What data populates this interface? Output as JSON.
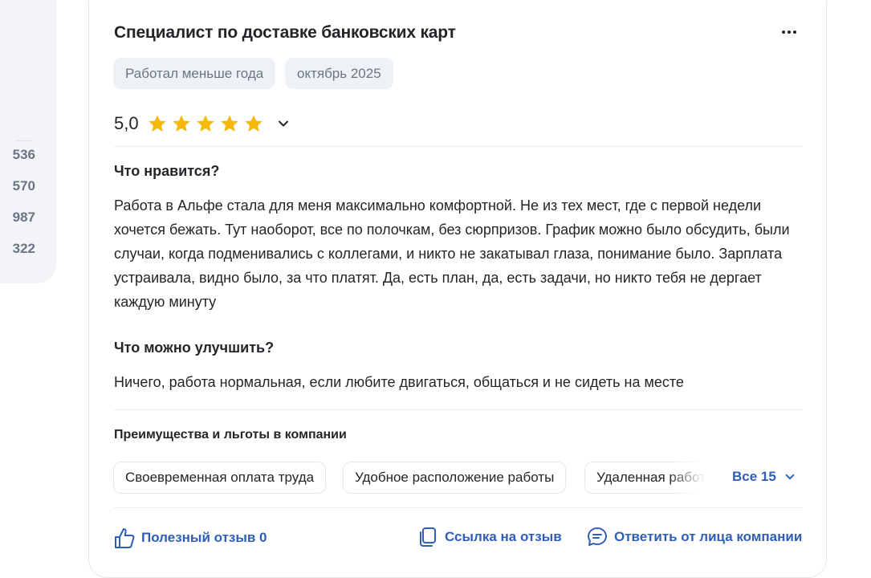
{
  "sidebar": {
    "stats": [
      "536",
      "570",
      "987",
      "322"
    ]
  },
  "review": {
    "title": "Специалист по доставке банковских карт",
    "tags": [
      "Работал меньше года",
      "октябрь 2025"
    ],
    "rating": "5,0",
    "stars": 5,
    "likes_heading": "Что нравится?",
    "likes_text": "Работа в Альфе стала для меня максимально комфортной. Не из тех мест, где с первой недели хочется бежать. Тут наоборот, все по полочкам, без сюрпризов. График можно было обсудить, были случаи, когда подменивались с коллегами, и никто не закатывал глаза, понимание было. Зарплата устраивала, видно было, за что платят. Да, есть план, да, есть задачи, но никто тебя не дергает каждую минуту",
    "improve_heading": "Что можно улучшить?",
    "improve_text": "Ничего, работа нормальная, если любите двигаться, общаться и не сидеть на месте",
    "benefits_heading": "Преимущества и льготы в компании",
    "benefits": [
      "Своевременная оплата труда",
      "Удобное расположение работы",
      "Удаленная работа"
    ],
    "all_benefits_label": "Все 15",
    "actions": {
      "helpful": "Полезный отзыв 0",
      "link": "Ссылка на отзыв",
      "reply": "Ответить от лица компании"
    }
  },
  "colors": {
    "accent": "#2f5eb8",
    "star": "#f8b808",
    "chip_bg": "#eef1f5",
    "muted_text": "#6a7585"
  },
  "icons": [
    "more-icon",
    "star-icon",
    "chevron-down-icon",
    "thumbs-up-icon",
    "copy-link-icon",
    "chat-icon"
  ]
}
